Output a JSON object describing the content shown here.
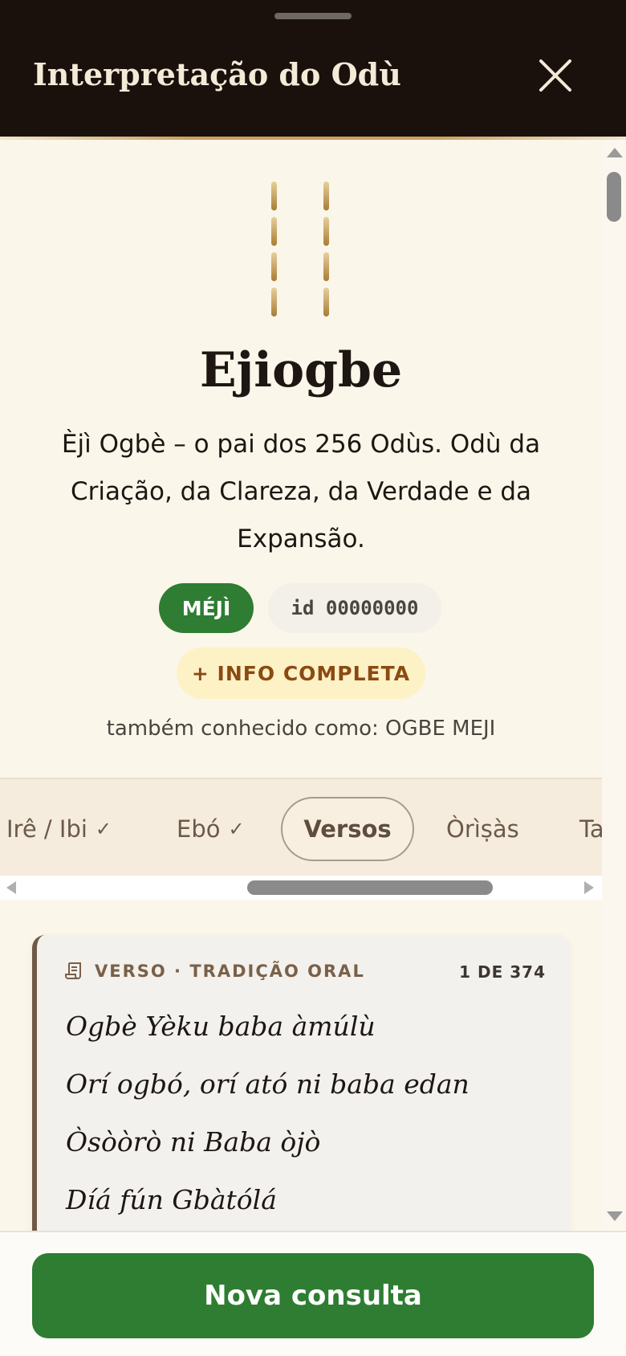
{
  "header": {
    "title": "Interpretação do Odù"
  },
  "odu": {
    "name": "Ejiogbe",
    "description": "Èjì Ogbè – o pai dos 256 Odùs. Odù da Criação, da Clareza, da Verdade e da Expansão.",
    "badge_type": "MÉJÌ",
    "badge_id": "id 00000000",
    "info_button": "+ INFO COMPLETA",
    "also_known_as": "também conhecido como: OGBE MEJI"
  },
  "tabs": [
    {
      "label": "Irê / Ibi",
      "check": "✓"
    },
    {
      "label": "Ebó",
      "check": "✓"
    },
    {
      "label": "Versos",
      "active": true
    },
    {
      "label": "Òrìṣàs"
    },
    {
      "label": "Ta"
    }
  ],
  "verse": {
    "label": "VERSO · TRADIÇÃO ORAL",
    "count": "1 DE 374",
    "lines": [
      "Ogbè Yèku baba àmúlù",
      "Orí ogbó, orí ató ni baba edan",
      "Òsòòrò ni Baba òjò",
      "Díá fún Gbàtólá"
    ]
  },
  "footer": {
    "new_consult": "Nova consulta"
  },
  "colors": {
    "header_bg": "#1a110d",
    "accent_green": "#2e7d32",
    "gold": "#c9a25f",
    "info_bg": "#fdf1c6",
    "info_text": "#8a4a12"
  },
  "icons": {
    "close": "close-icon",
    "verse": "scroll-icon",
    "check": "checkmark-icon"
  }
}
